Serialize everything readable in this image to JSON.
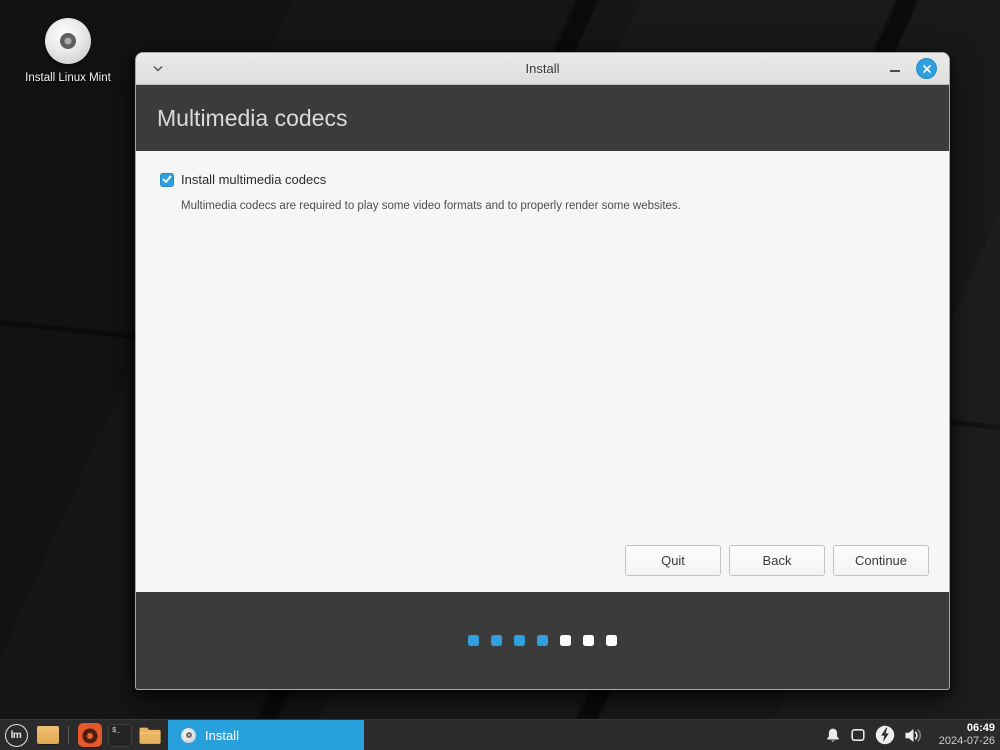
{
  "colors": {
    "accent_blue": "#2f9fde",
    "taskbar_blue": "#28a0dc",
    "header_dark": "#3b3b3b",
    "content_bg": "#f6f6f5",
    "taskbar_bg": "#2b2b2b"
  },
  "desktop": {
    "icon": {
      "icon_name": "cd-disc-icon",
      "label": "Install Linux Mint"
    }
  },
  "window": {
    "titlebar": {
      "title": "Install",
      "left_icon": "chevron-down-icon",
      "minimize_icon": "minimize-icon",
      "close_icon": "close-icon"
    },
    "header_title": "Multimedia codecs",
    "content": {
      "checkbox": {
        "label": "Install multimedia codecs",
        "checked": true
      },
      "description": "Multimedia codecs are required to play some video formats and to properly render some websites."
    },
    "buttons": [
      {
        "label": "Quit"
      },
      {
        "label": "Back"
      },
      {
        "label": "Continue"
      }
    ],
    "progress": {
      "steps_total": 7,
      "steps_done": 4
    }
  },
  "taskbar": {
    "menu_glyph": "lm",
    "terminal_glyph": "$_",
    "launcher_icons": [
      "mint-menu-icon",
      "show-desktop-icon",
      "firefox-icon",
      "terminal-icon",
      "file-manager-icon"
    ],
    "active_task": {
      "icon_name": "cd-disc-icon",
      "label": "Install"
    },
    "tray_icons": [
      "notifications-bell-icon",
      "removable-media-icon",
      "power-icon",
      "volume-icon"
    ],
    "clock": {
      "time": "06:49",
      "date": "2024-07-26"
    }
  }
}
